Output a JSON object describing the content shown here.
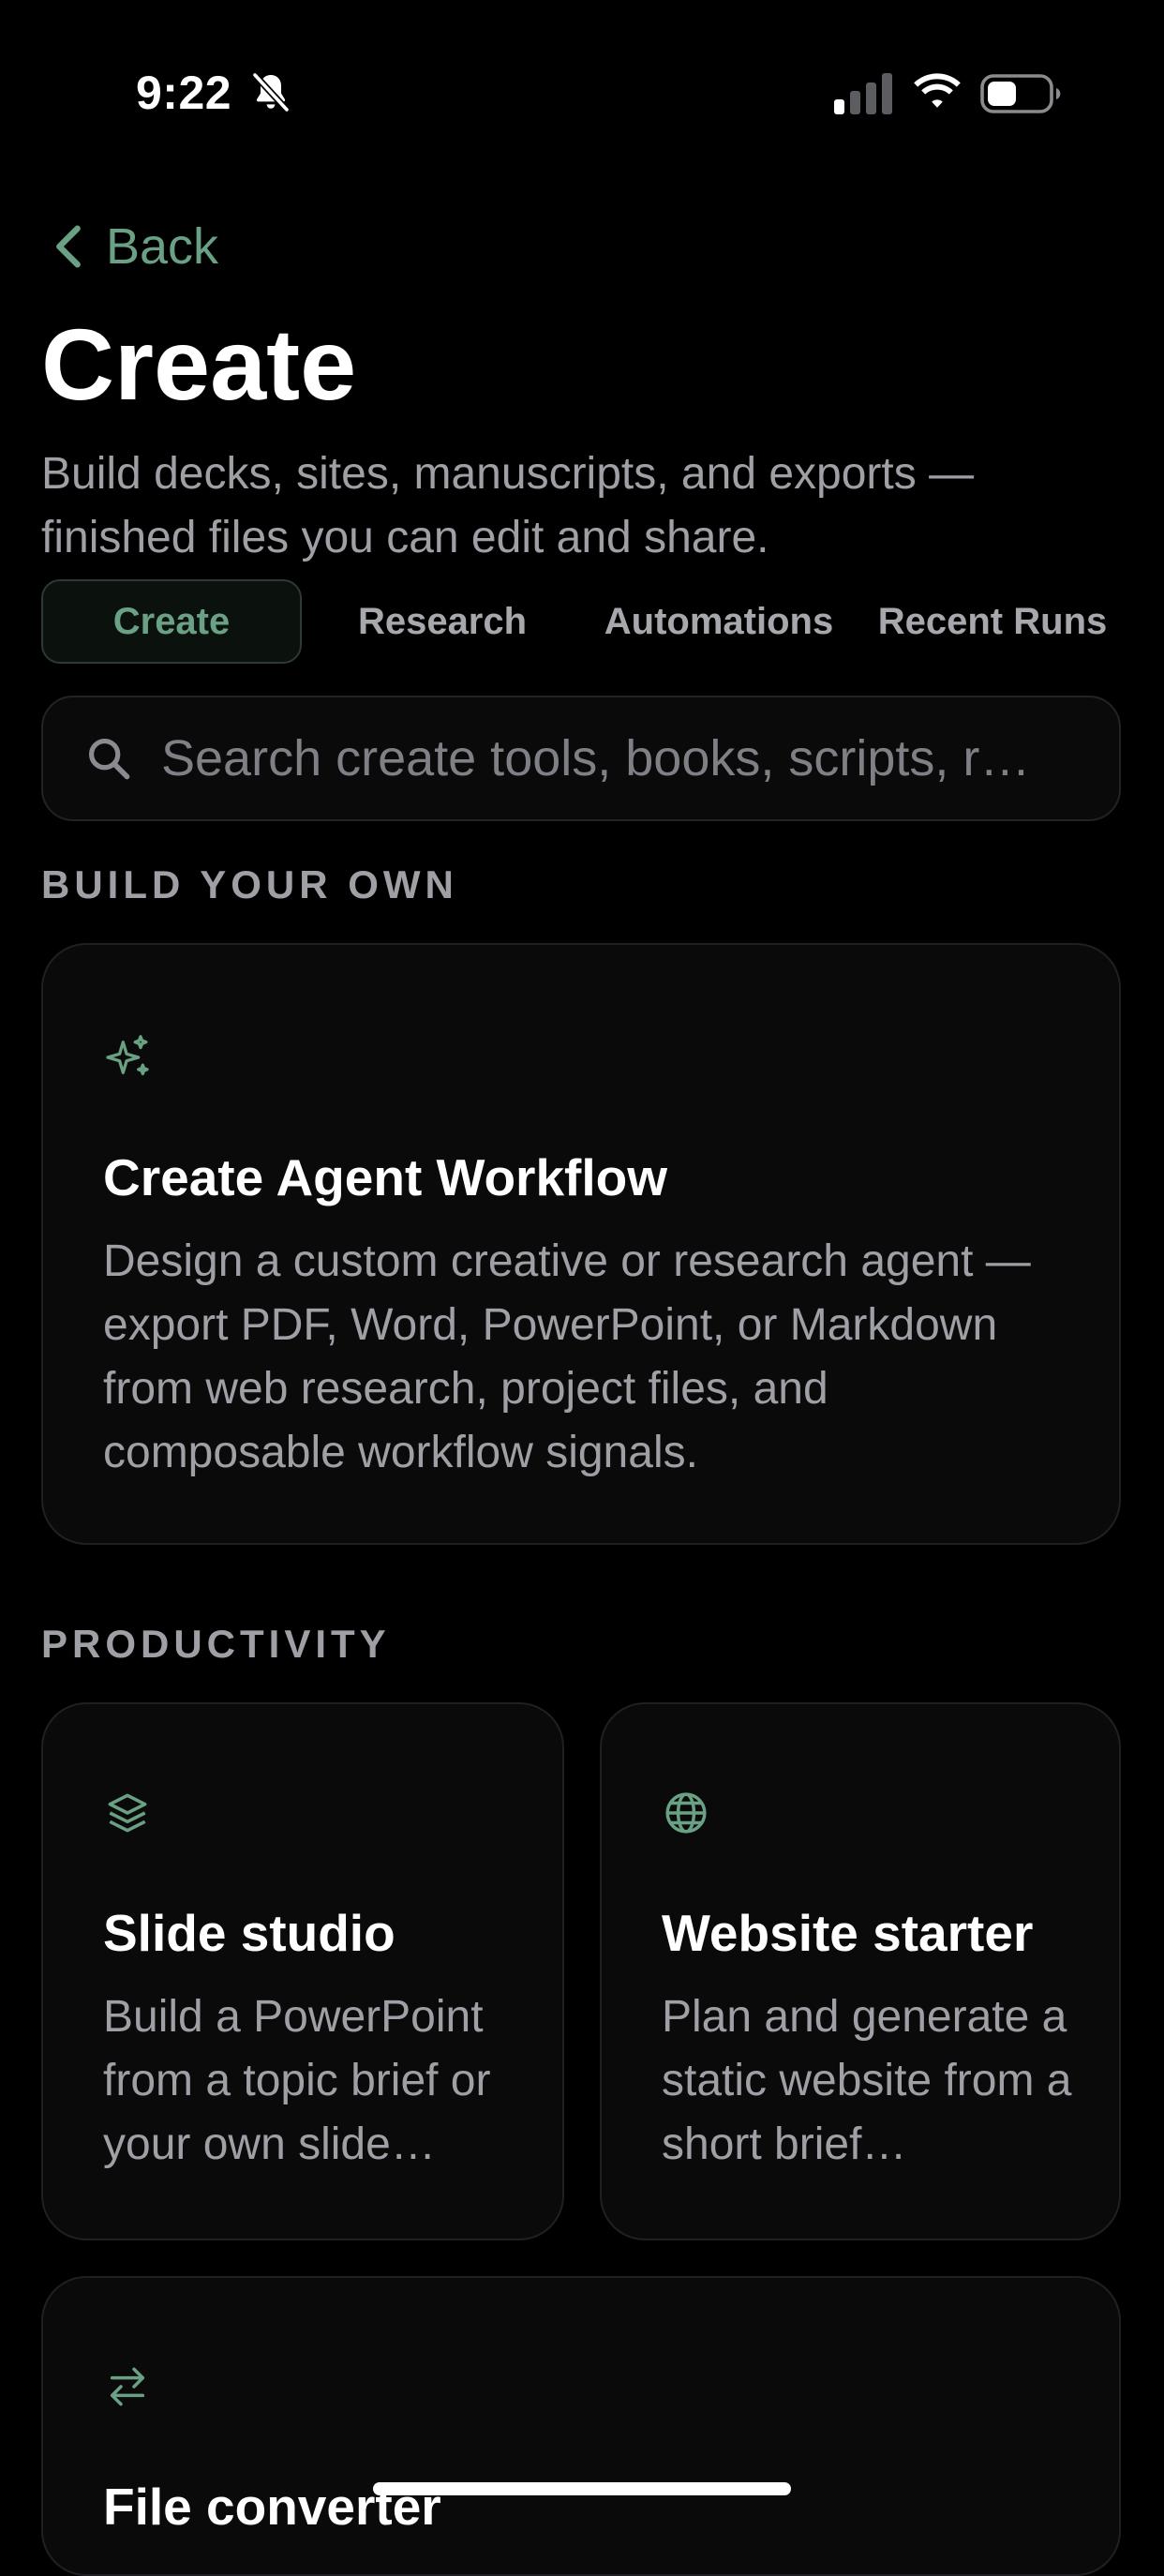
{
  "status_bar": {
    "time": "9:22",
    "icons": [
      "bell-slash-icon",
      "cellular-signal-icon",
      "wifi-icon",
      "battery-icon"
    ]
  },
  "nav": {
    "back_label": "Back"
  },
  "header": {
    "title": "Create",
    "subtitle": "Build decks, sites, manuscripts, and exports — finished files you can edit and share."
  },
  "tabs": [
    {
      "label": "Create",
      "active": true
    },
    {
      "label": "Research",
      "active": false
    },
    {
      "label": "Automations",
      "active": false
    },
    {
      "label": "Recent Runs",
      "active": false
    }
  ],
  "search": {
    "placeholder": "Search create tools, books, scripts, r…",
    "value": ""
  },
  "sections": {
    "build_your_own": {
      "label": "BUILD YOUR OWN",
      "cards": [
        {
          "icon": "sparkles-icon",
          "title": "Create Agent Workflow",
          "description": "Design a custom creative or research agent — export PDF, Word, PowerPoint, or Markdown from web research, project files, and composable workflow signals."
        }
      ]
    },
    "productivity": {
      "label": "PRODUCTIVITY",
      "cards": [
        {
          "icon": "layers-icon",
          "title": "Slide studio",
          "description": "Build a PowerPoint from a topic brief or your own slide…"
        },
        {
          "icon": "globe-icon",
          "title": "Website starter",
          "description": "Plan and generate a static website from a short brief…"
        },
        {
          "icon": "arrows-swap-icon",
          "title": "File converter"
        }
      ]
    }
  },
  "colors": {
    "accent": "#6aa184",
    "background": "#000000",
    "card": "#0a0a0b",
    "muted_text": "#9ea0a6"
  }
}
